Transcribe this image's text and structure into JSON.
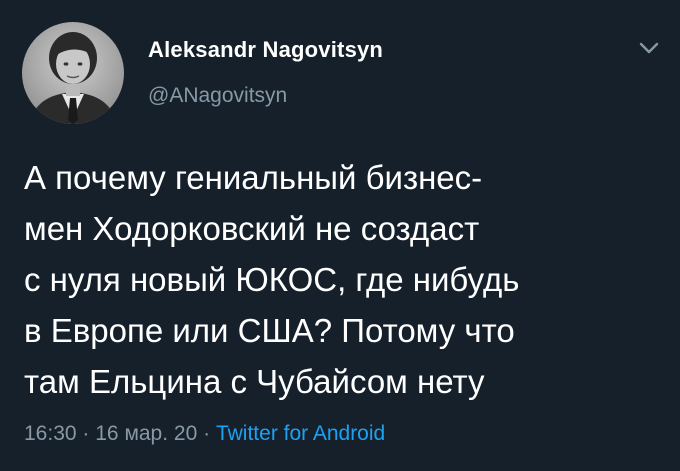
{
  "author": {
    "name": "Aleksandr Nagovitsyn",
    "handle": "@ANagovitsyn"
  },
  "tweet": {
    "lines": [
      "А почему гениальный бизнес-",
      "мен Ходорковский не создаст",
      "с нуля новый ЮКОС, где нибудь",
      "в Европе или США? Потому что",
      "там Ельцина с Чубайсом нету"
    ],
    "time": "16:30",
    "date": "16 мар. 20",
    "separator": "·",
    "source": "Twitter for Android"
  },
  "icons": {
    "menu": "chevron-down-icon",
    "avatar": "profile-photo"
  },
  "colors": {
    "background": "#15202b",
    "text": "#ffffff",
    "secondary_text": "#8899a6",
    "link": "#1da1f2"
  }
}
